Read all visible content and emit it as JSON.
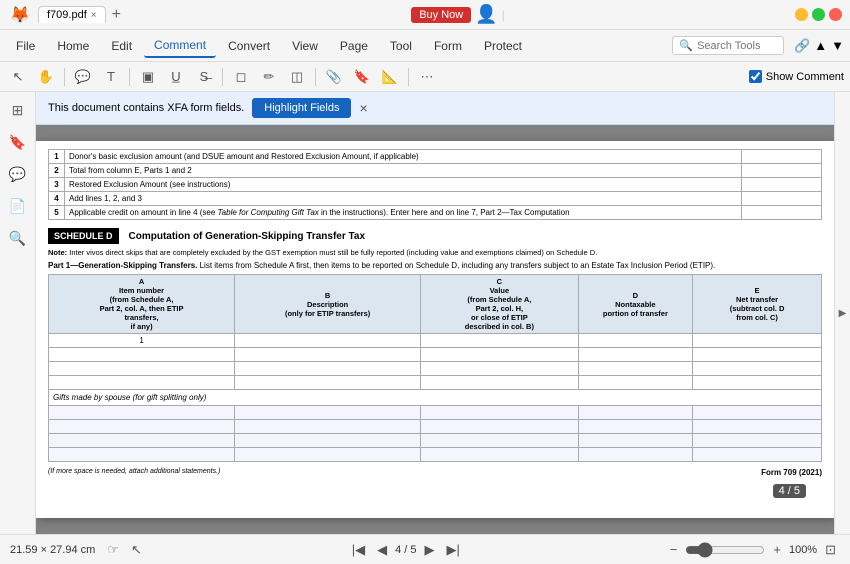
{
  "titlebar": {
    "app_icon": "foxitpdf-icon",
    "filename": "f709.pdf",
    "close_tab": "×",
    "new_tab": "+",
    "buy_now": "Buy Now",
    "win_close": "×",
    "win_min": "−",
    "win_max": "□"
  },
  "menubar": {
    "items": [
      {
        "label": "File",
        "id": "file"
      },
      {
        "label": "Home",
        "id": "home"
      },
      {
        "label": "Edit",
        "id": "edit"
      },
      {
        "label": "Comment",
        "id": "comment",
        "active": true
      },
      {
        "label": "Convert",
        "id": "convert"
      },
      {
        "label": "View",
        "id": "view"
      },
      {
        "label": "Page",
        "id": "page"
      },
      {
        "label": "Tool",
        "id": "tool"
      },
      {
        "label": "Form",
        "id": "form"
      },
      {
        "label": "Protect",
        "id": "protect"
      }
    ],
    "search_placeholder": "Search Tools"
  },
  "toolbar": {
    "show_comment_label": "Show Comment"
  },
  "xfa_bar": {
    "message": "This document contains XFA form fields.",
    "button": "Highlight Fields",
    "close": "×"
  },
  "pdf": {
    "page_info": "4 / 5",
    "dimensions": "21.59 × 27.94 cm",
    "zoom": "100%",
    "badge": "4 / 5",
    "schedule": {
      "label": "SCHEDULE D",
      "title": "Computation of Generation-Skipping Transfer Tax",
      "note": "Note: Inter vivos direct skips that are completely excluded by the GST exemption must still be fully reported (including value and exemptions claimed) on Schedule D.",
      "part1_header": "Part 1—Generation-Skipping Transfers.",
      "part1_desc": "List items from Schedule A first, then items to be reported on Schedule D, including any transfers subject to an Estate Tax Inclusion Period (ETIP).",
      "columns": [
        "A\nItem number\n(from Schedule A,\nPart 2, col. A, then ETIP\ntransfers,\nif any)",
        "B\nDescription\n(only for ETIP transfers)",
        "C\nValue\n(from Schedule A,\nPart 2, col. H,\nor close of ETIP\ndescribed in col. B)",
        "D\nNontaxable\nportion of transfer",
        "E\nNet transfer\n(subtract col. D\nfrom col. C)"
      ],
      "row1_num": "1",
      "gifts_label": "Gifts made by spouse (for gift splitting only)",
      "footer": "(If more space is needed, attach additional statements.)",
      "form_number": "Form 709 (2021)"
    },
    "lines": [
      {
        "num": "1",
        "label": "Donor's basic exclusion amount (and DSUE amount and Restored Exclusion Amount, if applicable)"
      },
      {
        "num": "2",
        "label": "Total from column E, Parts 1 and 2"
      },
      {
        "num": "3",
        "label": "Restored Exclusion Amount (see instructions)"
      },
      {
        "num": "4",
        "label": "Add lines 1, 2, and 3"
      },
      {
        "num": "5",
        "label": "Applicable credit on amount in line 4 (see Table for Computing Gift Tax in the instructions). Enter here and on line 7, Part 2—Tax Computation"
      }
    ]
  },
  "sidebar_icons": [
    "page-thumbnail-icon",
    "bookmark-icon",
    "comment-icon",
    "attachment-icon",
    "search-icon"
  ]
}
